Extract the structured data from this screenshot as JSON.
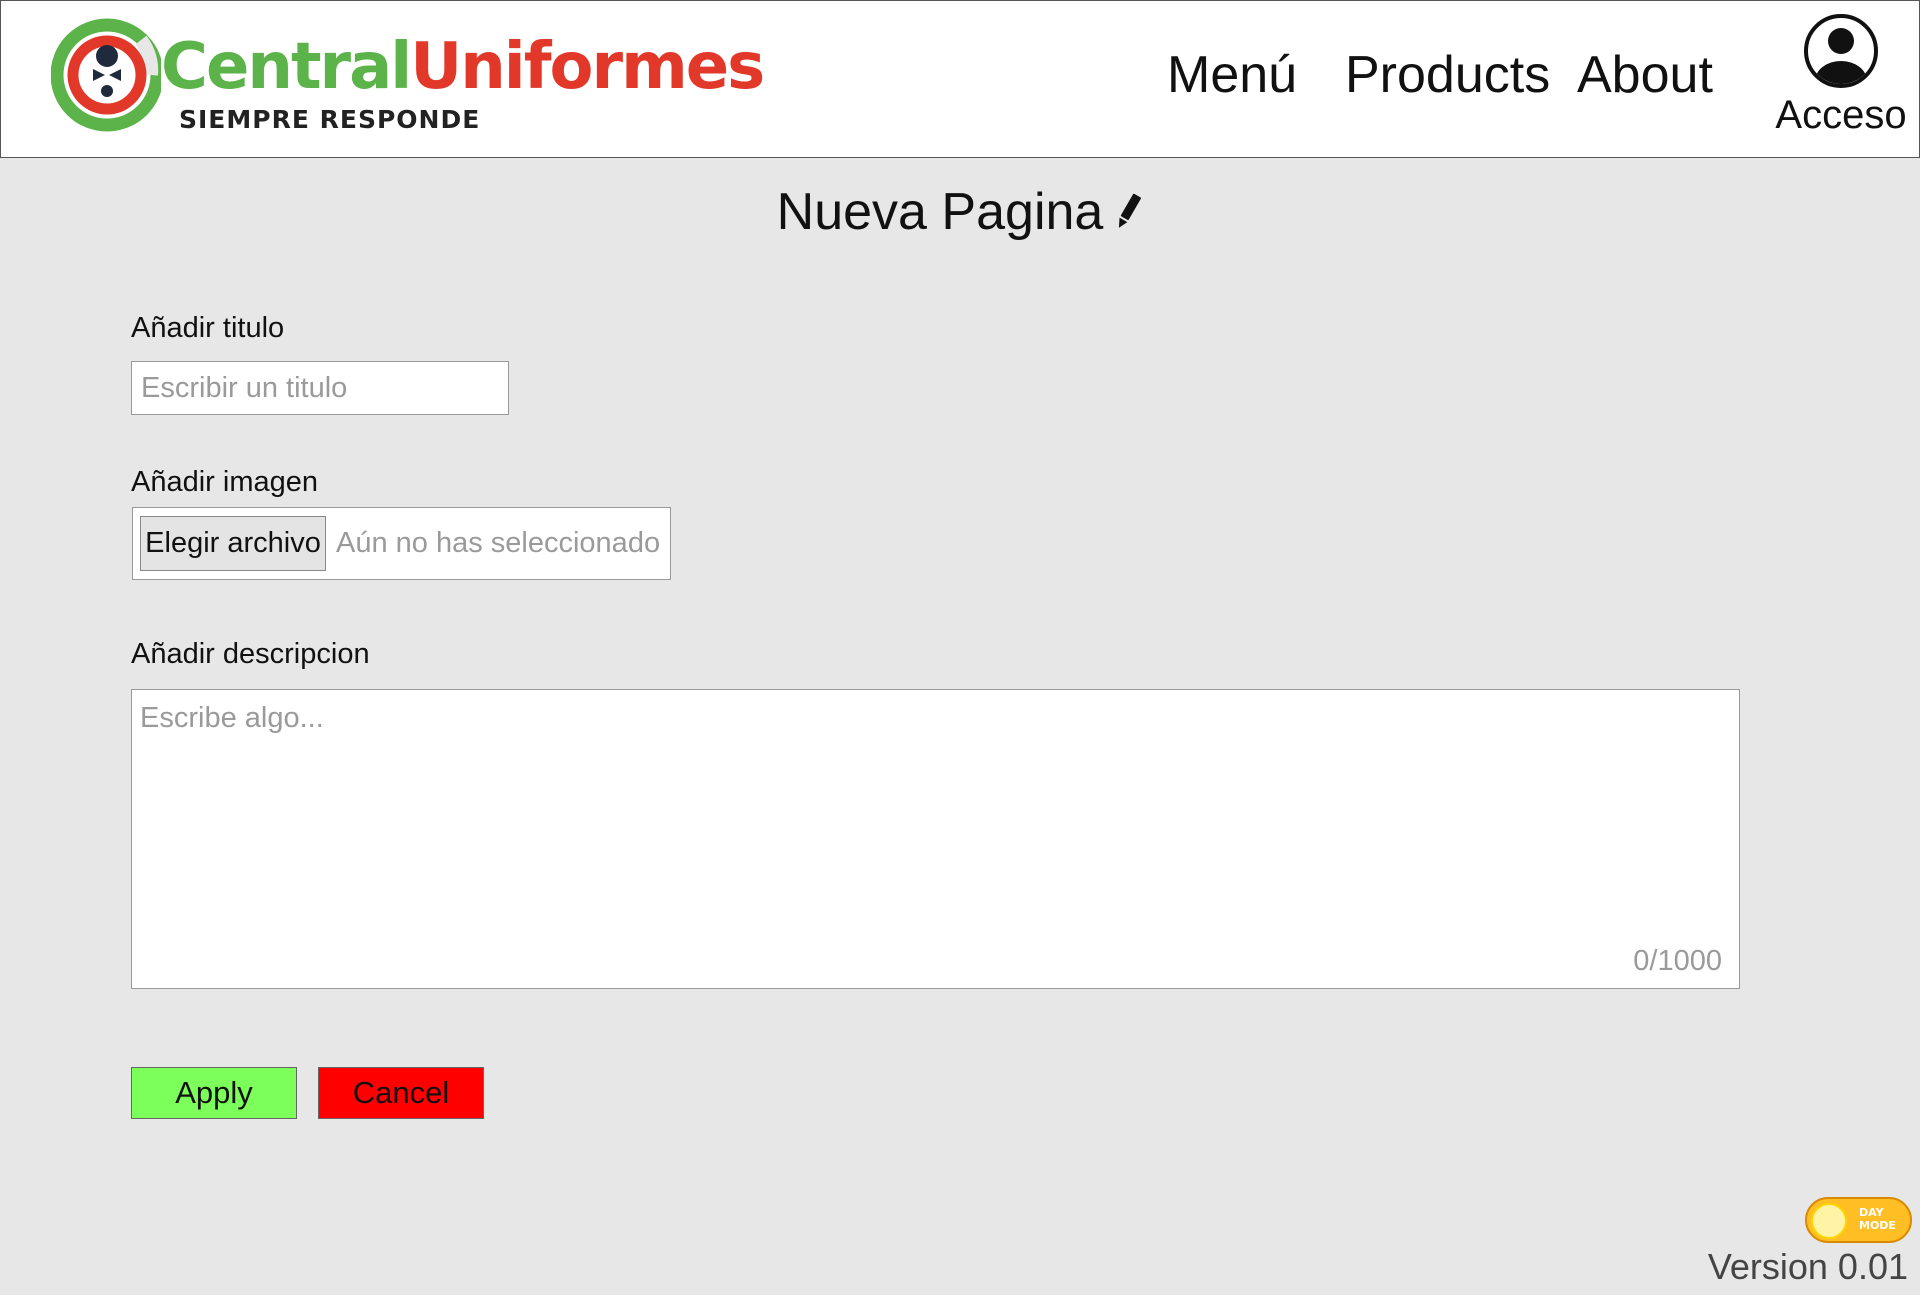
{
  "header": {
    "logo": {
      "brand_part1": "Central",
      "brand_part2": "Uniformes",
      "tagline": "SIEMPRE RESPONDE",
      "colors": {
        "green": "#5bb34a",
        "red": "#e2382a"
      }
    },
    "nav": {
      "menu": "Menú",
      "products": "Products",
      "about": "About"
    },
    "account": {
      "label": "Acceso",
      "icon": "user-circle-icon"
    }
  },
  "page": {
    "title": "Nueva Pagina",
    "title_icon": "pencil-icon"
  },
  "form": {
    "title_label": "Añadir titulo",
    "title_placeholder": "Escribir un titulo",
    "title_value": "",
    "image_label": "Añadir imagen",
    "file_button": "Elegir archivo",
    "file_status": "Aún no has seleccionado",
    "description_label": "Añadir descripcion",
    "description_placeholder": "Escribe algo...",
    "description_value": "",
    "char_count": "0/1000"
  },
  "actions": {
    "apply": "Apply",
    "cancel": "Cancel",
    "colors": {
      "apply": "#7cff5a",
      "cancel": "#ff0000"
    }
  },
  "footer": {
    "theme_toggle": {
      "line1": "DAY",
      "line2": "MODE",
      "state": "day"
    },
    "version": "Version 0.01"
  }
}
